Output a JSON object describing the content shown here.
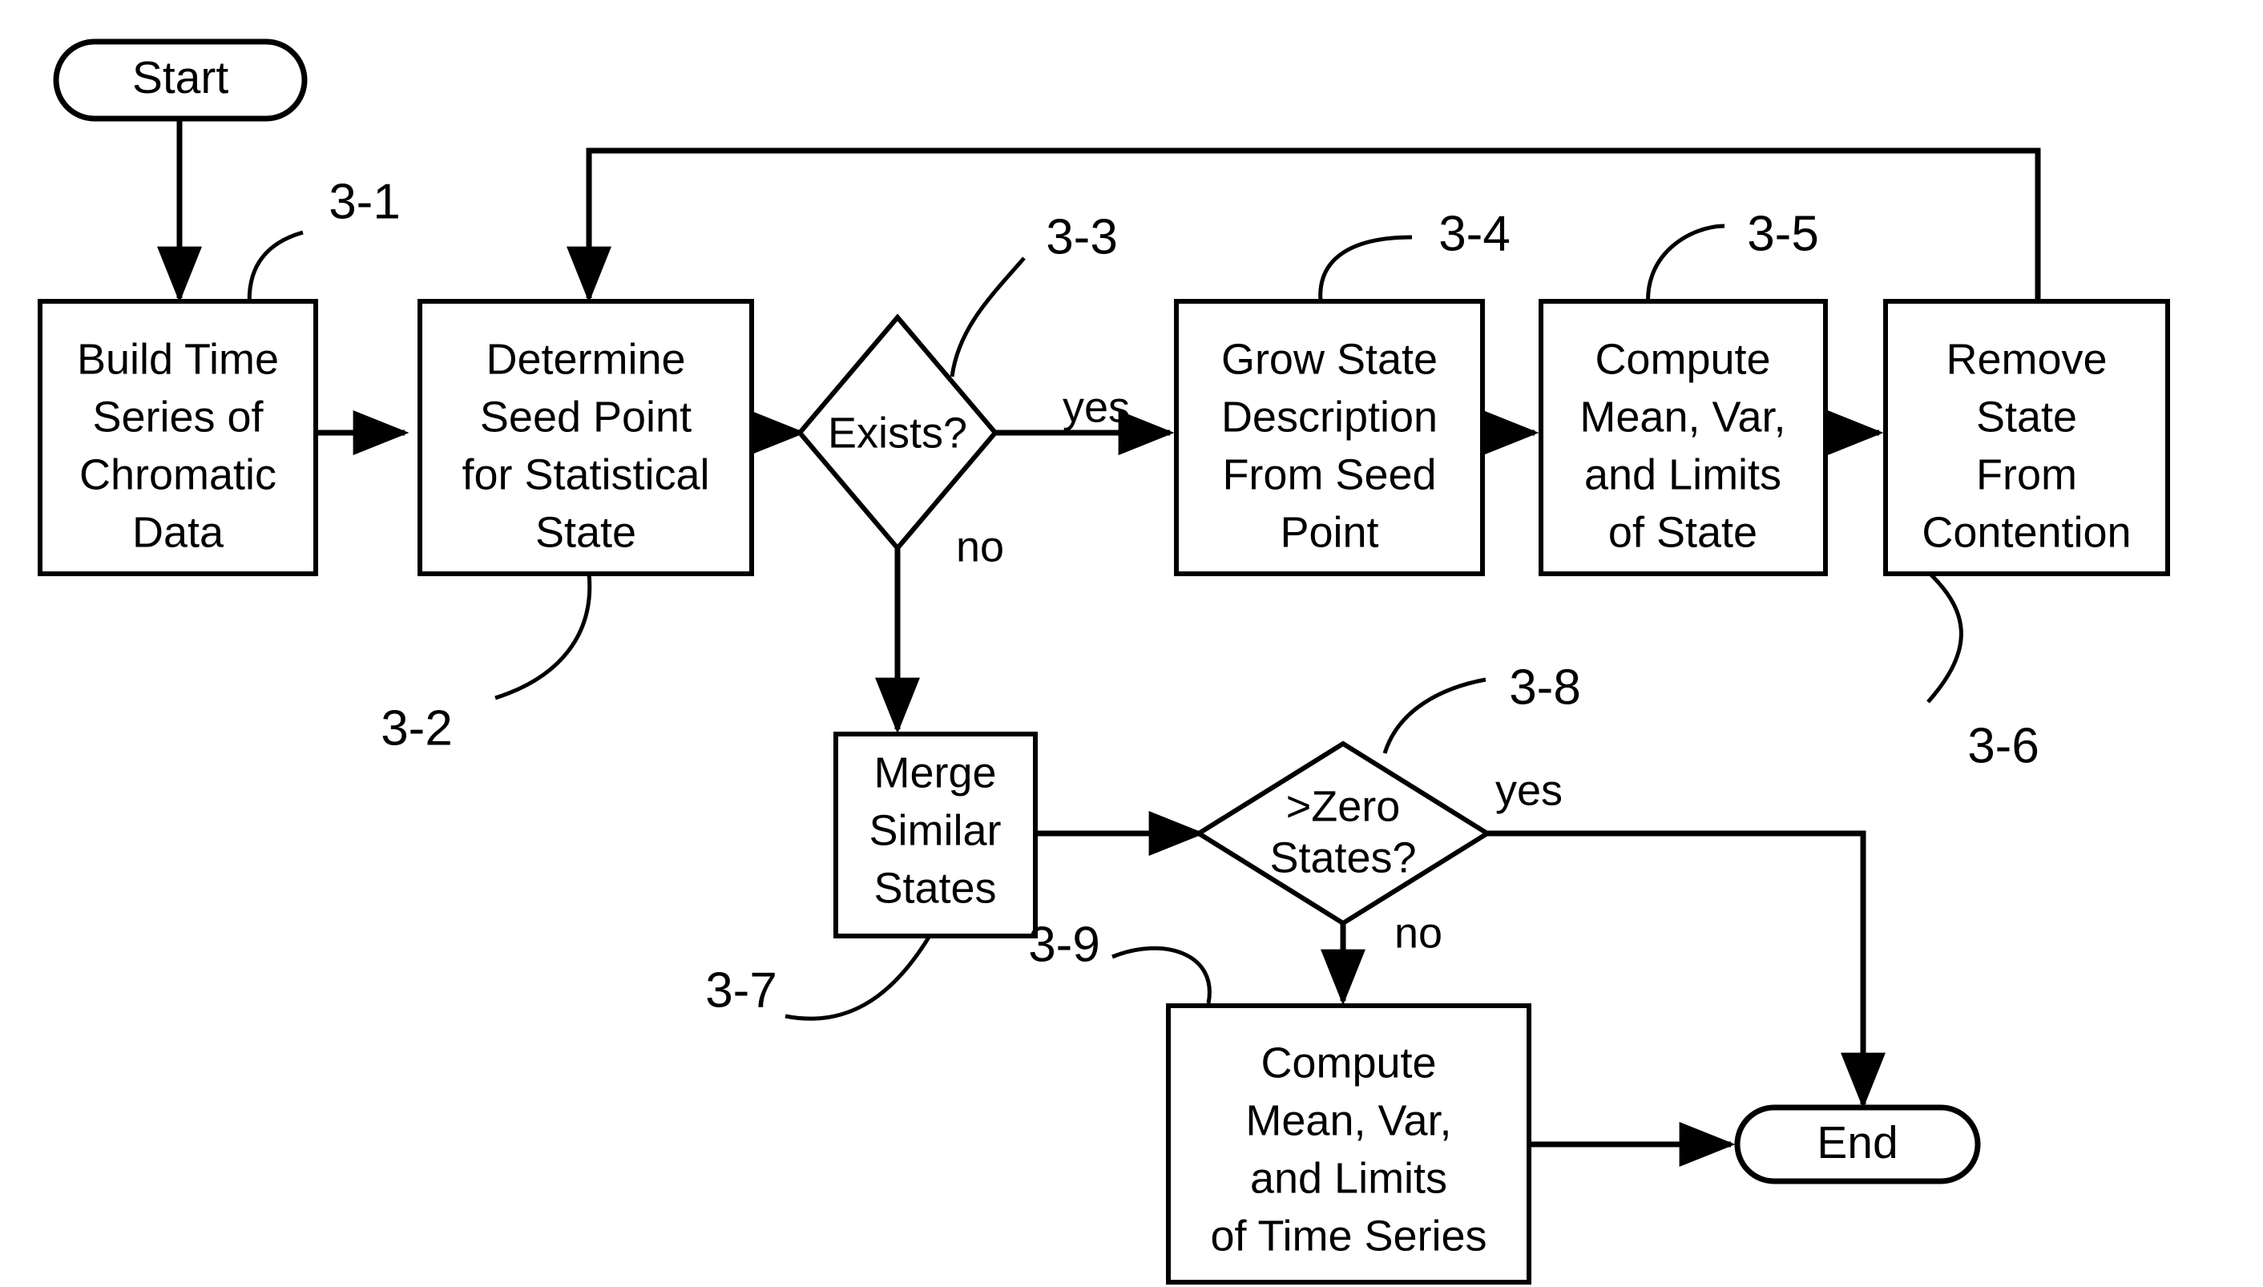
{
  "diagram": {
    "title": "Statistical State Time Series Flowchart",
    "colors": {
      "stroke": "#000000",
      "fill": "#ffffff",
      "text": "#000000"
    },
    "nodes": {
      "start": {
        "type": "terminator",
        "label": "Start"
      },
      "build_time_series": {
        "type": "process",
        "lines": [
          "Build Time",
          "Series of",
          "Chromatic",
          "Data"
        ]
      },
      "determine_seed_point": {
        "type": "process",
        "lines": [
          "Determine",
          "Seed Point",
          "for Statistical",
          "State"
        ]
      },
      "exists_decision": {
        "type": "decision",
        "lines": [
          "Exists?"
        ]
      },
      "grow_state_description": {
        "type": "process",
        "lines": [
          "Grow State",
          "Description",
          "From Seed",
          "Point"
        ]
      },
      "compute_state_stats": {
        "type": "process",
        "lines": [
          "Compute",
          "Mean, Var,",
          "and Limits",
          "of State"
        ]
      },
      "remove_state": {
        "type": "process",
        "lines": [
          "Remove",
          "State",
          "From",
          "Contention"
        ]
      },
      "merge_similar_states": {
        "type": "process",
        "lines": [
          "Merge",
          "Similar",
          "States"
        ]
      },
      "zero_states_decision": {
        "type": "decision",
        "lines": [
          ">Zero",
          "States?"
        ]
      },
      "compute_series_stats": {
        "type": "process",
        "lines": [
          "Compute",
          "Mean, Var,",
          "and Limits",
          "of Time Series"
        ]
      },
      "end": {
        "type": "terminator",
        "label": "End"
      }
    },
    "edge_labels": {
      "exists_yes": "yes",
      "exists_no": "no",
      "zero_states_yes": "yes",
      "zero_states_no": "no"
    },
    "reference_numerals": {
      "r31": "3-1",
      "r32": "3-2",
      "r33": "3-3",
      "r34": "3-4",
      "r35": "3-5",
      "r36": "3-6",
      "r37": "3-7",
      "r38": "3-8",
      "r39": "3-9"
    }
  }
}
